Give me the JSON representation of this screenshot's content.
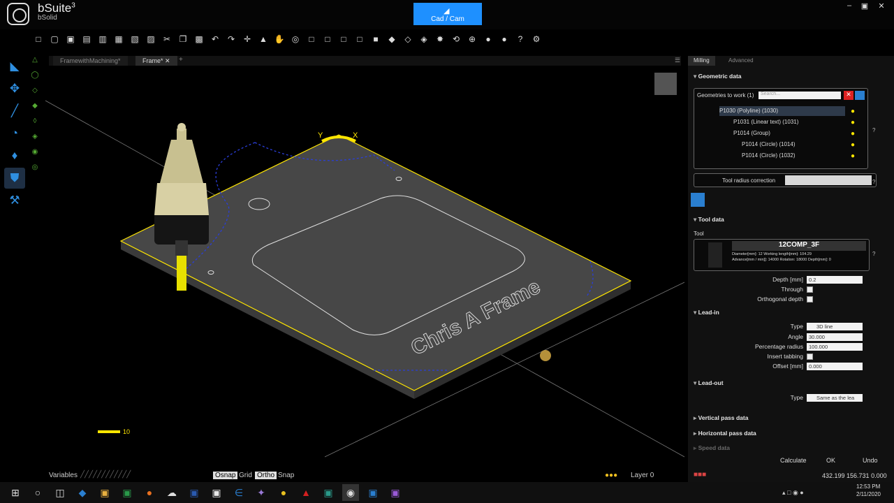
{
  "app": {
    "name": "bSuite",
    "version_sup": "3",
    "subtitle": "bSolid",
    "mode_button": "Cad / Cam"
  },
  "window_controls": {
    "minimize": "–",
    "restore": "▣",
    "close": "✕"
  },
  "toolbar_icons": [
    "new-file-icon",
    "open-folder-icon",
    "save-icon",
    "save-as-icon",
    "export-icon",
    "import-icon",
    "import-2-icon",
    "print-icon",
    "cut-icon",
    "copy-icon",
    "paste-icon",
    "undo-icon",
    "redo-icon",
    "move-icon",
    "select-icon",
    "pan-hand-icon",
    "zoom-icon",
    "view-front-icon",
    "view-back-icon",
    "view-left-icon",
    "view-right-icon",
    "view-top-icon",
    "view-iso-icon",
    "view-3d-icon",
    "cube-icon",
    "render-icon",
    "lasso-icon",
    "grid-icon",
    "sphere-icon",
    "sphere-2-icon",
    "help-icon",
    "settings-icon"
  ],
  "toolbar_glyphs": [
    "□",
    "▢",
    "▣",
    "▤",
    "▥",
    "▦",
    "▧",
    "▨",
    "✂",
    "❐",
    "▩",
    "↶",
    "↷",
    "✛",
    "▲",
    "✋",
    "◎",
    "□",
    "□",
    "□",
    "□",
    "■",
    "◆",
    "◇",
    "◈",
    "✸",
    "⟲",
    "⊕",
    "●",
    "●",
    "?",
    "⚙"
  ],
  "left_tools": [
    {
      "name": "draw-tool-icon",
      "glyph": "◣"
    },
    {
      "name": "transform-tool-icon",
      "glyph": "✥"
    },
    {
      "name": "edit-tool-icon",
      "glyph": "╱"
    },
    {
      "name": "dimension-tool-icon",
      "glyph": "◔"
    },
    {
      "name": "machining-tool-icon",
      "glyph": "♦"
    },
    {
      "name": "cam-shield-icon",
      "glyph": "⛊"
    },
    {
      "name": "wrench-tool-icon",
      "glyph": "⚒"
    }
  ],
  "doc_tabs": [
    "FramewithMachining*",
    "Frame*"
  ],
  "add_tab": "+",
  "viewport": {
    "axis_y": "Y",
    "axis_x": "X",
    "engraved_text": "Chris A Frame",
    "scale_value": "10"
  },
  "statusbar": {
    "variables": "Variables",
    "osnap": "Osnap",
    "grid": "Grid",
    "ortho": "Ortho",
    "snap": "Snap",
    "layer": "Layer 0",
    "coords": "432.199  156.731  0.000"
  },
  "right_panel": {
    "tabs": [
      "Milling",
      "Advanced"
    ],
    "geometric_data": "Geometric data",
    "geometries_label": "Geometries to work (1)",
    "search_placeholder": "Search...",
    "tree": [
      {
        "label": "P1030 (Polyline) (1030)",
        "selected": true
      },
      {
        "label": "P1031 (Linear text) (1031)",
        "selected": false
      },
      {
        "label": "P1014 (Group)",
        "selected": false
      },
      {
        "label": "P1014 (Circle) (1014)",
        "selected": false
      },
      {
        "label": "P1014 (Circle) (1032)",
        "selected": false
      }
    ],
    "tool_radius_correction": "Tool radius correction",
    "tool_data": "Tool data",
    "tool_label": "Tool",
    "tool_name": "12COMP_3F",
    "tool_line1": "Diameter[mm]: 12  Working length[mm]: 104.29",
    "tool_line2": "Advance[mm / min]]: 14000  Rotation: 18000  Depth[mm]: 0",
    "depth_label": "Depth [mm]",
    "depth_value": "0.2",
    "through_label": "Through",
    "orthogonal_label": "Orthogonal depth",
    "lead_in": "Lead-in",
    "type_label": "Type",
    "type_value": "3D line",
    "angle_label": "Angle",
    "angle_value": "30.000",
    "percent_label": "Percentage radius",
    "percent_value": "100.000",
    "insert_tabbing_label": "Insert tabbing",
    "offset_label": "Offset [mm]",
    "offset_value": "0.000",
    "lead_out": "Lead-out",
    "type2_label": "Type",
    "type2_value": "Same as the lea",
    "vertical_pass": "Vertical pass data",
    "horizontal_pass": "Horizontal pass data",
    "speed_data": "Speed data",
    "calculate": "Calculate",
    "ok": "OK",
    "undo": "Undo",
    "question": "?"
  },
  "taskbar": {
    "time": "12:53 PM",
    "date": "2/11/2020"
  },
  "colors": {
    "accent": "#1e90ff",
    "edge": "#ffe600",
    "panel": "#111111"
  }
}
